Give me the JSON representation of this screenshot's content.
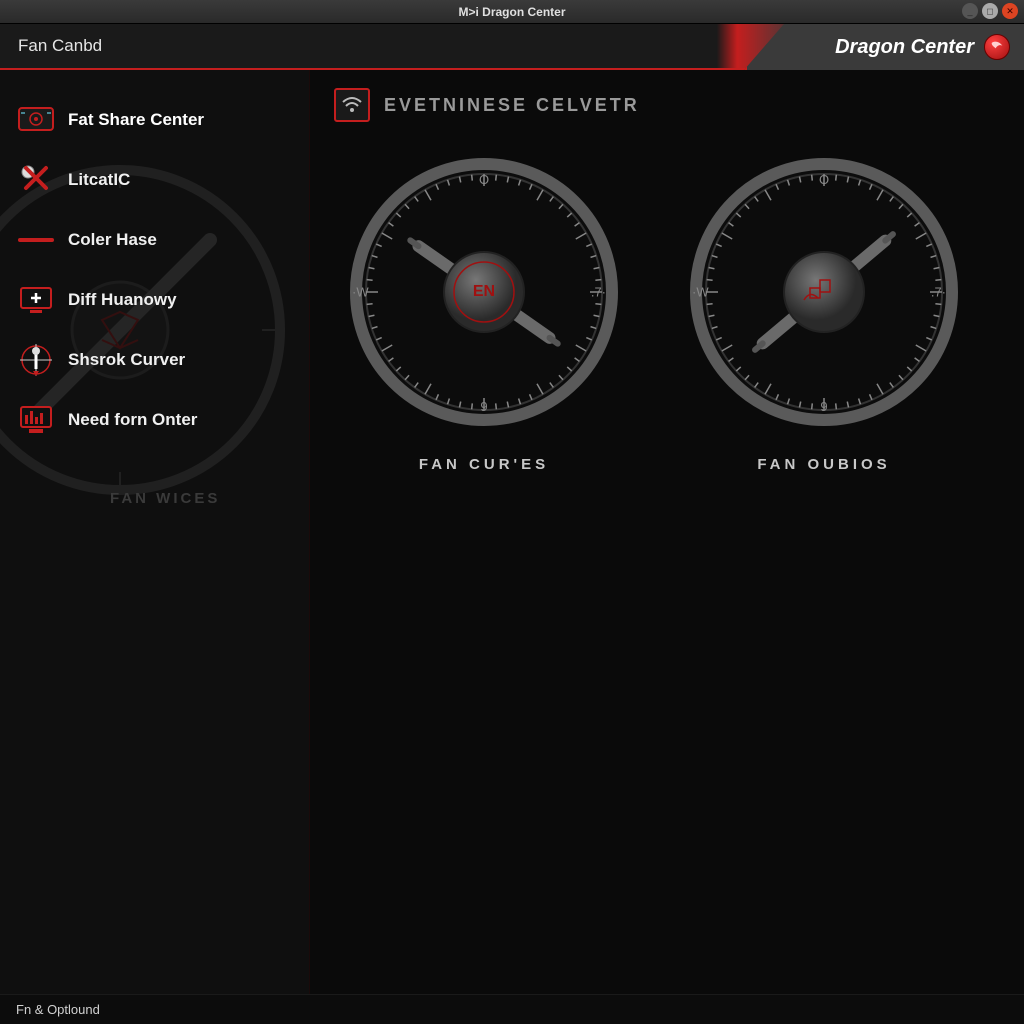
{
  "window": {
    "title": "M>i Dragon Center"
  },
  "header": {
    "breadcrumb": "Fan Canbd",
    "brand": "Dragon Center"
  },
  "sidebar": {
    "items": [
      {
        "label": "Fat Share Center",
        "icon": "monitor-gauge-icon"
      },
      {
        "label": "LitcatIC",
        "icon": "x-mark-icon"
      },
      {
        "label": "Coler Hase",
        "icon": "red-bar-icon"
      },
      {
        "label": "Diff Huanowy",
        "icon": "screen-plus-icon"
      },
      {
        "label": "Shsrok Curver",
        "icon": "crosshair-icon"
      },
      {
        "label": "Need forn Onter",
        "icon": "bars-screen-icon"
      }
    ],
    "ghost_label": "FAN WICES"
  },
  "section": {
    "title": "EVETNINESE CELVETR"
  },
  "gauges": [
    {
      "label": "FAN CUR'ES",
      "center_text": "EN",
      "marks": {
        "top": "O",
        "left": "·W",
        "right": ".7·",
        "bottom": "9"
      },
      "needle_angle": 215
    },
    {
      "label": "FAN OUBIOS",
      "center_text": "",
      "marks": {
        "top": "O",
        "left": "·W",
        "right": ".7·",
        "bottom": "9"
      },
      "needle_angle": 140
    }
  ],
  "footer": {
    "text": "Fn & Optlound"
  },
  "colors": {
    "accent": "#c41e1e",
    "bg": "#0a0a0a"
  }
}
